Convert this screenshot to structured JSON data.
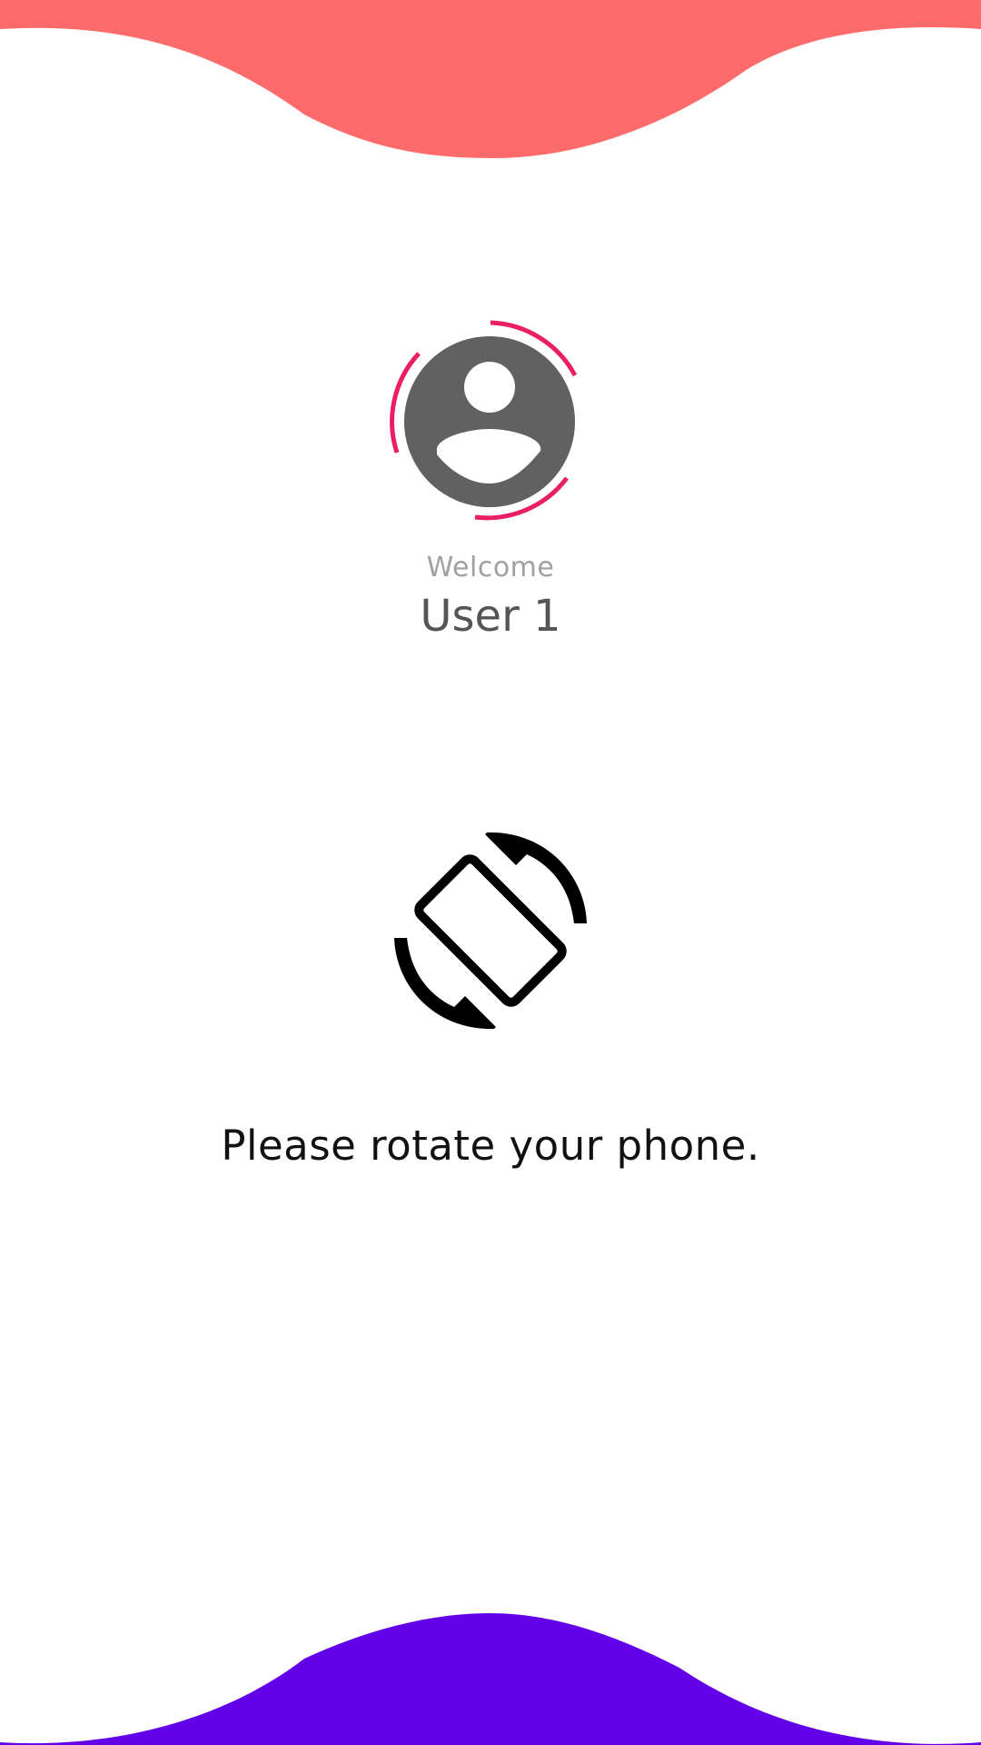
{
  "colors": {
    "top_wave": "#FF6B6B",
    "bottom_wave": "#6200EA",
    "avatar_ring": "#E91E63",
    "avatar_fill": "#616161",
    "welcome_text": "#A0A0A0",
    "username_text": "#555555",
    "message_text": "#111111"
  },
  "profile": {
    "avatar_icon": "account-circle-icon",
    "welcome_label": "Welcome",
    "username": "User 1"
  },
  "orientation_prompt": {
    "icon": "screen-rotation-icon",
    "message": "Please rotate your phone."
  }
}
